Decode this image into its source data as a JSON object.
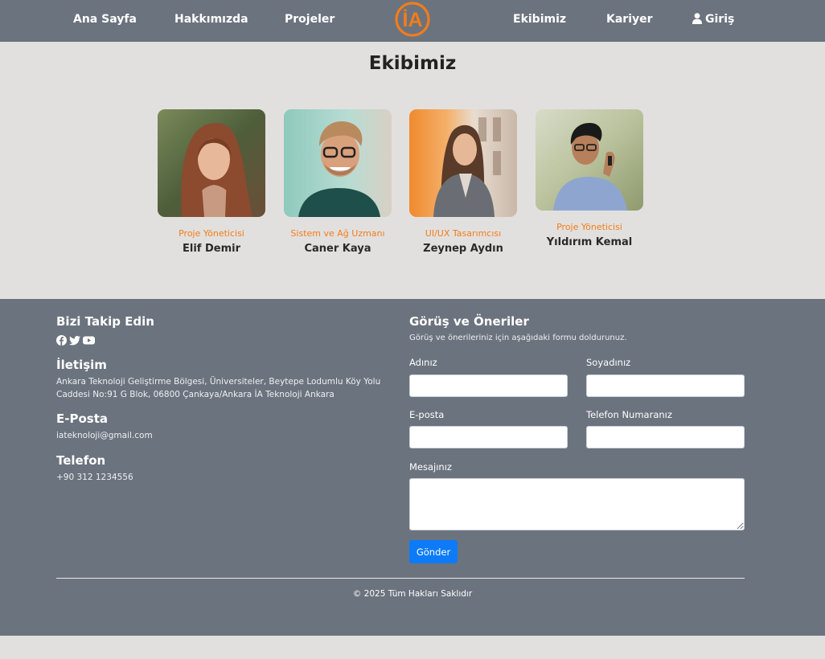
{
  "nav": {
    "home": "Ana Sayfa",
    "about": "Hakkımızda",
    "projects": "Projeler",
    "logo_text": "İA",
    "team": "Ekibimiz",
    "careers": "Kariyer",
    "login": "Giriş"
  },
  "team": {
    "title": "Ekibimiz",
    "members": [
      {
        "role": "Proje Yöneticisi",
        "name": "Elif Demir"
      },
      {
        "role": "Sistem ve Ağ Uzmanı",
        "name": "Caner Kaya"
      },
      {
        "role": "UI/UX Tasarımcısı",
        "name": "Zeynep Aydın"
      },
      {
        "role": "Proje Yöneticisi",
        "name": "Yıldırım Kemal"
      }
    ]
  },
  "footer": {
    "follow_title": "Bizi Takip Edin",
    "social_icons": [
      "facebook-icon",
      "twitter-icon",
      "youtube-icon"
    ],
    "contact_title": "İletişim",
    "address": "Ankara Teknoloji Geliştirme Bölgesi, Üniversiteler, Beytepe Lodumlu Köy Yolu Caddesi No:91 G Blok, 06800 Çankaya/Ankara İA Teknoloji Ankara",
    "email_title": "E-Posta",
    "email": "iateknoloji@gmail.com",
    "phone_title": "Telefon",
    "phone": "+90 312 1234556",
    "form": {
      "title": "Görüş ve Öneriler",
      "subtitle": "Görüş ve önerileriniz için aşağıdaki formu doldurunuz.",
      "first_name_label": "Adınız",
      "first_name_value": "",
      "last_name_label": "Soyadınız",
      "last_name_value": "",
      "email_label": "E-posta",
      "email_value": "",
      "phone_label": "Telefon Numaranız",
      "phone_value": "",
      "message_label": "Mesajınız",
      "message_value": "",
      "submit_label": "Gönder"
    },
    "copyright": "© 2025 Tüm Hakları Saklıdır"
  },
  "colors": {
    "nav_bg": "#6b737e",
    "page_bg": "#e2e0de",
    "accent_orange": "#f17d1a",
    "primary_button": "#0d7bf7"
  }
}
